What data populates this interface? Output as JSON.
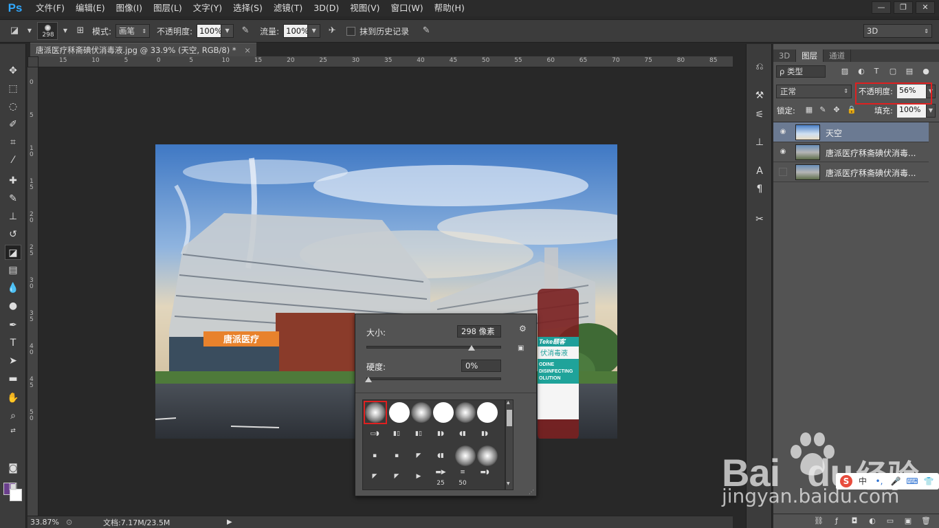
{
  "app": {
    "logo": "Ps"
  },
  "menu": [
    "文件(F)",
    "编辑(E)",
    "图像(I)",
    "图层(L)",
    "文字(Y)",
    "选择(S)",
    "滤镜(T)",
    "3D(D)",
    "视图(V)",
    "窗口(W)",
    "帮助(H)"
  ],
  "window_controls": [
    "—",
    "❐",
    "✕"
  ],
  "options": {
    "brush_size": "298",
    "mode_label": "模式:",
    "mode_value": "画笔",
    "opacity_label": "不透明度:",
    "opacity_value": "100%",
    "flow_label": "流量:",
    "flow_value": "100%",
    "erase_history_label": "抹到历史记录",
    "preset_3d": "3D"
  },
  "document": {
    "tab_title": "唐派医疗秝斋碘伏消毒液.jpg @ 33.9% (天空, RGB/8) *",
    "close_symbol": "×",
    "zoom": "33.87%",
    "doc_info": "文档:7.17M/23.5M"
  },
  "ruler_h": [
    "15",
    "10",
    "5",
    "0",
    "5",
    "10",
    "15",
    "20",
    "25",
    "30",
    "35",
    "40",
    "45",
    "50",
    "55",
    "60",
    "65",
    "70",
    "75",
    "80",
    "85"
  ],
  "ruler_v": [
    "0",
    "5",
    "1 0",
    "1 5",
    "2 0",
    "2 5",
    "3 0",
    "3 5",
    "4 0",
    "4 5",
    "5 0"
  ],
  "brush_popup": {
    "size_label": "大小:",
    "size_value": "298 像素",
    "size_fraction": 0.78,
    "hardness_label": "硬度:",
    "hardness_value": "0%",
    "hardness_fraction": 0.0,
    "preset_numbers": [
      "25",
      "50"
    ]
  },
  "photo_text": {
    "sign": "唐派医疗",
    "product_brand": "Teke颐客",
    "product_name": "伏消毒液",
    "product_en1": "ODINE",
    "product_en2": "DISINFECTING",
    "product_en3": "OLUTION"
  },
  "layers_panel": {
    "tabs": [
      "3D",
      "图层",
      "通道"
    ],
    "active_tab": "图层",
    "filter_label": "ρ 类型",
    "blend_mode": "正常",
    "opacity_label": "不透明度:",
    "opacity_value": "56%",
    "lock_label": "锁定:",
    "fill_label": "填充:",
    "fill_value": "100%",
    "layers": [
      {
        "name": "天空",
        "visible": true,
        "selected": true
      },
      {
        "name": "唐派医疗秝斋碘伏消毒...",
        "visible": true,
        "selected": false
      },
      {
        "name": "唐派医疗秝斋碘伏消毒...",
        "visible": false,
        "selected": false
      }
    ]
  },
  "watermark": {
    "brand": "Bai",
    "brand2": "du",
    "cn": "经验",
    "url": "jingyan.baidu.com"
  }
}
